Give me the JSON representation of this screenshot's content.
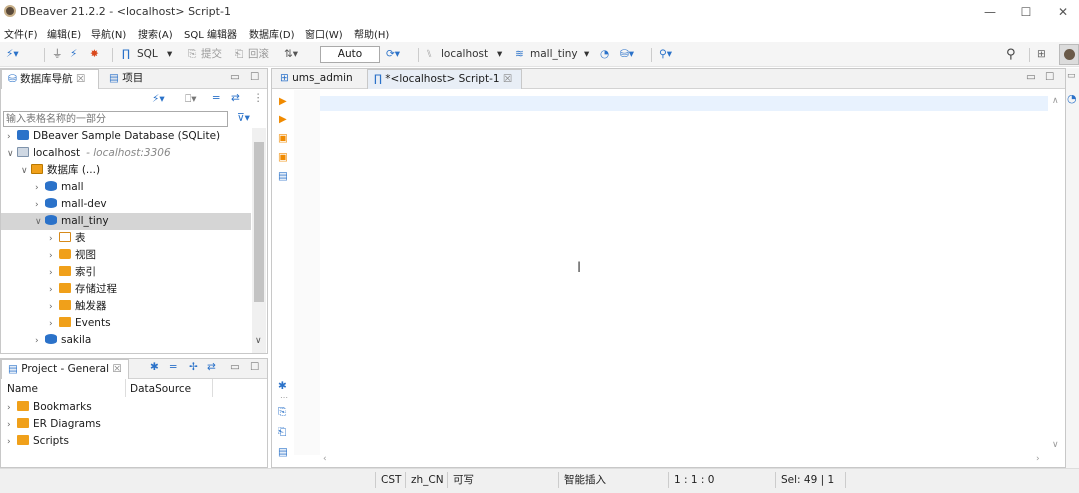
{
  "window": {
    "title": "DBeaver 21.2.2 - <localhost> Script-1",
    "minimize": "—",
    "maximize": "☐",
    "close": "✕"
  },
  "menu": [
    "文件(F)",
    "编辑(E)",
    "导航(N)",
    "搜索(A)",
    "SQL 编辑器",
    "数据库(D)",
    "窗口(W)",
    "帮助(H)"
  ],
  "toolbar": {
    "sql_label": "SQL",
    "commit_label": "提交",
    "rollback_label": "回滚",
    "transaction_mode": "Auto",
    "datasource": "localhost",
    "schema": "mall_tiny"
  },
  "navigator": {
    "tab_label": "数据库导航",
    "projects_tab_label": "项目",
    "filter_placeholder": "输入表格名称的一部分",
    "tree": [
      {
        "label": "DBeaver Sample Database (SQLite)",
        "indent": 0,
        "chev": "›",
        "icon": "sqlite"
      },
      {
        "label": "localhost",
        "suffix": "- localhost:3306",
        "indent": 0,
        "chev": "∨",
        "icon": "mysql"
      },
      {
        "label": "数据库 (...)",
        "indent": 1,
        "chev": "∨",
        "icon": "dbs"
      },
      {
        "label": "mall",
        "indent": 2,
        "chev": "›",
        "icon": "db"
      },
      {
        "label": "mall-dev",
        "indent": 2,
        "chev": "›",
        "icon": "db"
      },
      {
        "label": "mall_tiny",
        "indent": 2,
        "chev": "∨",
        "icon": "db",
        "selected": true
      },
      {
        "label": "表",
        "indent": 3,
        "chev": "›",
        "icon": "tables"
      },
      {
        "label": "视图",
        "indent": 3,
        "chev": "›",
        "icon": "views"
      },
      {
        "label": "索引",
        "indent": 3,
        "chev": "›",
        "icon": "folder"
      },
      {
        "label": "存储过程",
        "indent": 3,
        "chev": "›",
        "icon": "folder"
      },
      {
        "label": "触发器",
        "indent": 3,
        "chev": "›",
        "icon": "folder"
      },
      {
        "label": "Events",
        "indent": 3,
        "chev": "›",
        "icon": "folder"
      },
      {
        "label": "sakila",
        "indent": 2,
        "chev": "›",
        "icon": "db"
      }
    ]
  },
  "project": {
    "tab_label": "Project - General",
    "col_name": "Name",
    "col_datasource": "DataSource",
    "items": [
      "Bookmarks",
      "ER Diagrams",
      "Scripts"
    ]
  },
  "editor": {
    "tabs": [
      {
        "label": "ums_admin",
        "active": false
      },
      {
        "label": "*<localhost> Script-1",
        "active": true
      }
    ]
  },
  "status": {
    "timezone": "CST",
    "locale": "zh_CN",
    "mode": "可写",
    "insert_mode": "智能插入",
    "position": "1 : 1 : 0",
    "selection": "Sel: 49 | 1"
  }
}
